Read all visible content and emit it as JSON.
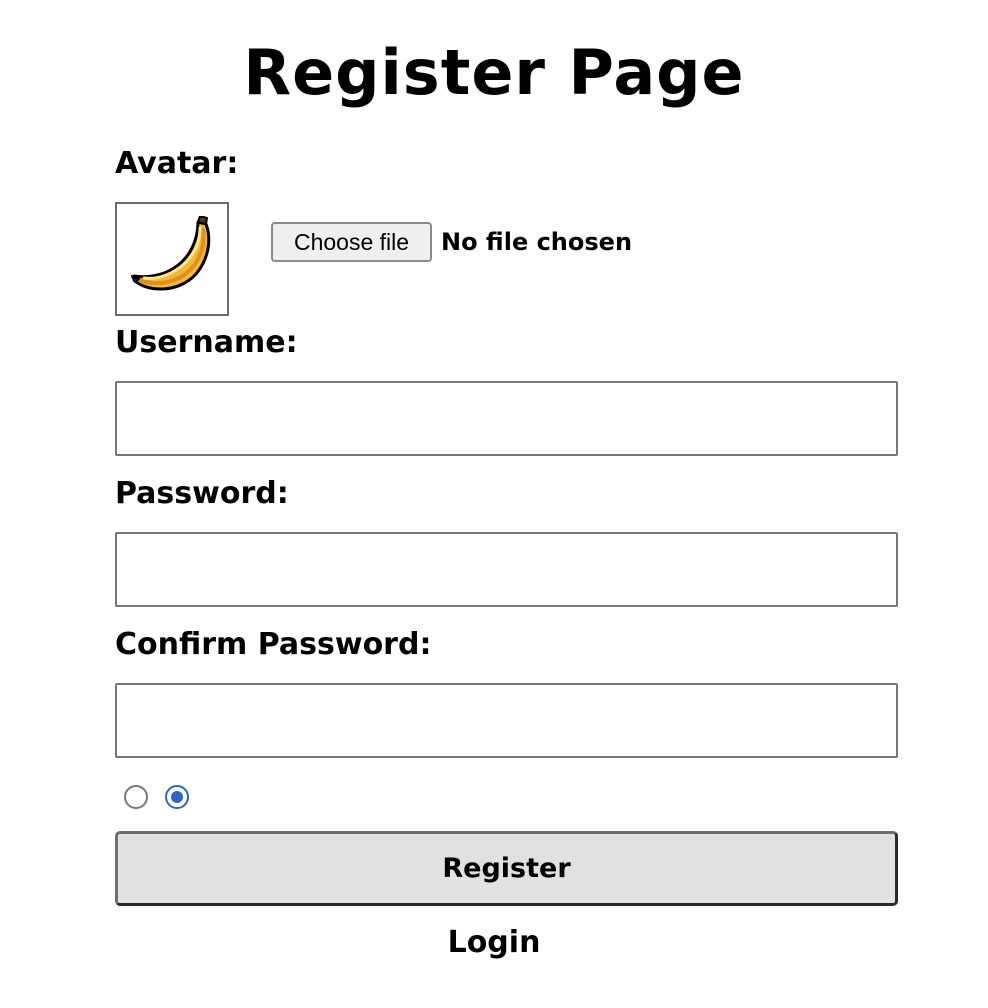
{
  "page": {
    "title": "Register Page"
  },
  "avatar": {
    "label": "Avatar:",
    "icon": "banana-icon",
    "choose_button": "Choose file",
    "file_status": "No file chosen"
  },
  "username": {
    "label": "Username:",
    "value": ""
  },
  "password": {
    "label": "Password:",
    "value": ""
  },
  "confirm_password": {
    "label": "Confirm Password:",
    "value": ""
  },
  "radios": {
    "options": [
      {
        "checked": false
      },
      {
        "checked": true
      }
    ],
    "checked_color": "#2f64c8"
  },
  "actions": {
    "register_label": "Register",
    "login_label": "Login"
  }
}
